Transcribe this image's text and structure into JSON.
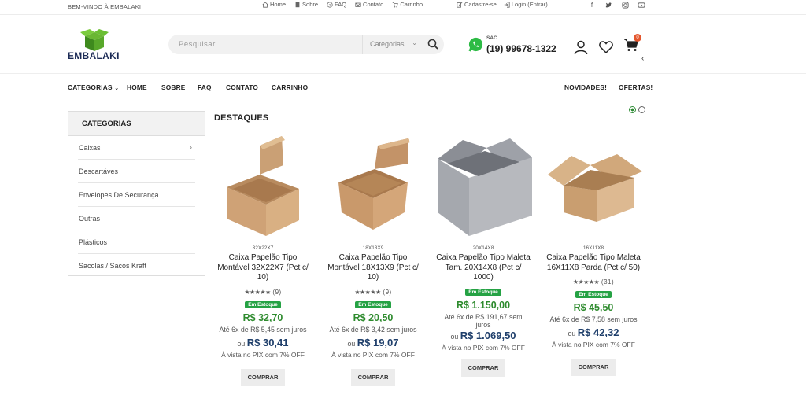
{
  "topbar": {
    "welcome": "BEM-VINDO À EMBALAKI",
    "links": [
      "Home",
      "Sobre",
      "FAQ",
      "Contato",
      "Carrinho"
    ],
    "account": [
      "Cadastre-se",
      "Login (Entrar)"
    ],
    "social_icons": [
      "facebook-icon",
      "twitter-icon",
      "instagram-icon",
      "youtube-icon"
    ]
  },
  "header": {
    "logo_text": "EMBALAKI",
    "search_placeholder": "Pesquisar...",
    "category_select": "Categorias",
    "sac_label": "SAC",
    "sac_phone": "(19) 99678-1322",
    "cart_count": "0"
  },
  "nav": {
    "categories": "CATEGORIAS",
    "items": [
      "HOME",
      "SOBRE",
      "FAQ",
      "CONTATO",
      "CARRINHO"
    ],
    "right": [
      "NOVIDADES!",
      "OFERTAS!"
    ]
  },
  "sidebar": {
    "title": "CATEGORIAS",
    "items": [
      "Caixas",
      "Descartáves",
      "Envelopes De Securança",
      "Outras",
      "Plásticos",
      "Sacolas / Sacos Kraft"
    ]
  },
  "section_title": "DESTAQUES",
  "products": [
    {
      "sku": "32X22X7",
      "name": "Caixa Papelão Tipo Montável 32X22X7 (Pct c/ 10)",
      "reviews": "(9)",
      "stock": "Em Estoque",
      "price": "R$ 32,70",
      "installments": "Até 6x de R$ 5,45 sem juros",
      "pix_prefix": "ou",
      "pix_price": "R$ 30,41",
      "pix_text": "À vista no PIX com 7% OFF",
      "buy": "COMPRAR"
    },
    {
      "sku": "18X13X9",
      "name": "Caixa Papelão Tipo Montável 18X13X9 (Pct c/ 10)",
      "reviews": "(9)",
      "stock": "Em Estoque",
      "price": "R$ 20,50",
      "installments": "Até 6x de R$ 3,42 sem juros",
      "pix_prefix": "ou",
      "pix_price": "R$ 19,07",
      "pix_text": "À vista no PIX com 7% OFF",
      "buy": "COMPRAR"
    },
    {
      "sku": "20X14X8",
      "name": "Caixa Papelão Tipo Maleta Tam. 20X14X8 (Pct c/ 1000)",
      "reviews": "",
      "stock": "Em Estoque",
      "price": "R$ 1.150,00",
      "installments": "Até 6x de R$ 191,67 sem juros",
      "pix_prefix": "ou",
      "pix_price": "R$ 1.069,50",
      "pix_text": "À vista no PIX com 7% OFF",
      "buy": "COMPRAR"
    },
    {
      "sku": "16X11X8",
      "name": "Caixa Papelão Tipo Maleta 16X11X8 Parda (Pct c/ 50)",
      "reviews": "(31)",
      "stock": "Em Estoque",
      "price": "R$ 45,50",
      "installments": "Até 6x de R$ 7,58 sem juros",
      "pix_prefix": "ou",
      "pix_price": "R$ 42,32",
      "pix_text": "À vista no PIX com 7% OFF",
      "buy": "COMPRAR"
    }
  ],
  "colors": {
    "accent_green": "#2e8b2e",
    "stock_badge": "#25a244",
    "pix_price": "#1f3f6b",
    "cart_badge": "#e4572e"
  }
}
